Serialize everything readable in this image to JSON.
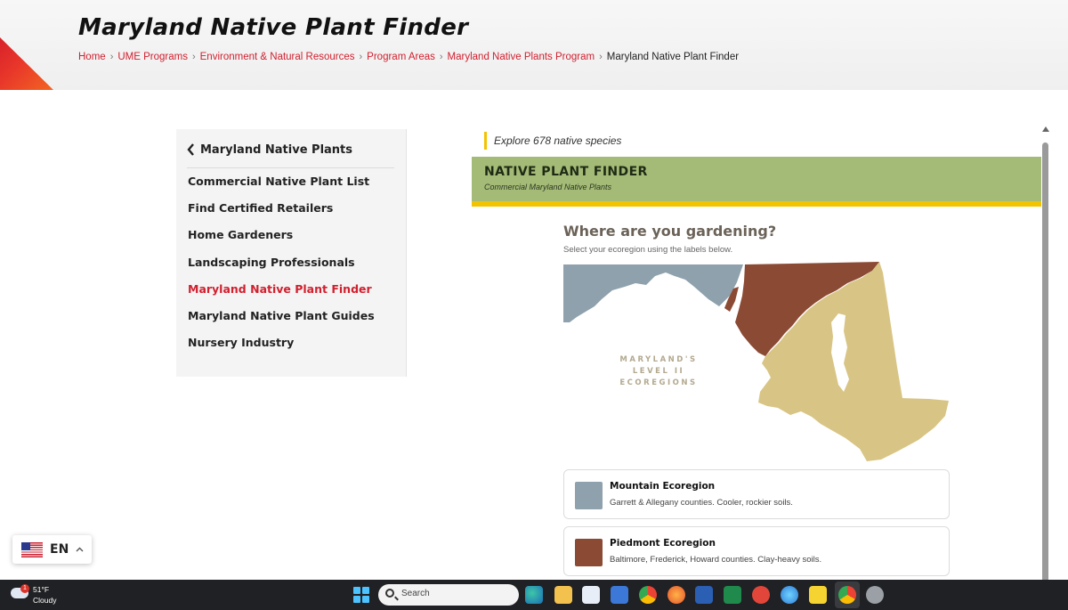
{
  "header": {
    "title": "Maryland Native Plant Finder",
    "breadcrumb": {
      "links": [
        "Home",
        "UME Programs",
        "Environment & Natural Resources",
        "Program Areas",
        "Maryland Native Plants Program"
      ],
      "current": "Maryland Native Plant Finder",
      "separator": "›"
    }
  },
  "sidebar": {
    "back_label": "Maryland Native Plants",
    "items": [
      {
        "label": "Commercial Native Plant List"
      },
      {
        "label": "Find Certified Retailers"
      },
      {
        "label": "Home Gardeners"
      },
      {
        "label": "Landscaping Professionals"
      },
      {
        "label": "Maryland Native Plant Finder"
      },
      {
        "label": "Maryland Native Plant Guides"
      },
      {
        "label": "Nursery Industry"
      }
    ],
    "active_index": 4
  },
  "main": {
    "explore_text": "Explore 678 native species",
    "finder_title": "NATIVE PLANT FINDER",
    "finder_subtitle": "Commercial Maryland Native Plants",
    "question": "Where are you gardening?",
    "instruction": "Select your ecoregion using the labels below.",
    "map_label_line1": "MARYLAND'S",
    "map_label_line2": "LEVEL II ECOREGIONS",
    "ecoregions": [
      {
        "name": "Mountain Ecoregion",
        "desc": "Garrett & Allegany counties. Cooler, rockier soils.",
        "color": "#8ea1ac"
      },
      {
        "name": "Piedmont Ecoregion",
        "desc": "Baltimore, Frederick, Howard counties. Clay-heavy soils.",
        "color": "#8b4a33"
      }
    ],
    "coastal_color": "#d8c585"
  },
  "language": {
    "code": "EN",
    "flag": "us-flag-icon"
  },
  "taskbar": {
    "temperature": "51°F",
    "condition": "Cloudy",
    "weather_badge": "1",
    "search_placeholder": "Search"
  },
  "colors": {
    "accent_red": "#d1202f",
    "accent_yellow": "#f2c300",
    "finder_green": "#a3bb77"
  }
}
